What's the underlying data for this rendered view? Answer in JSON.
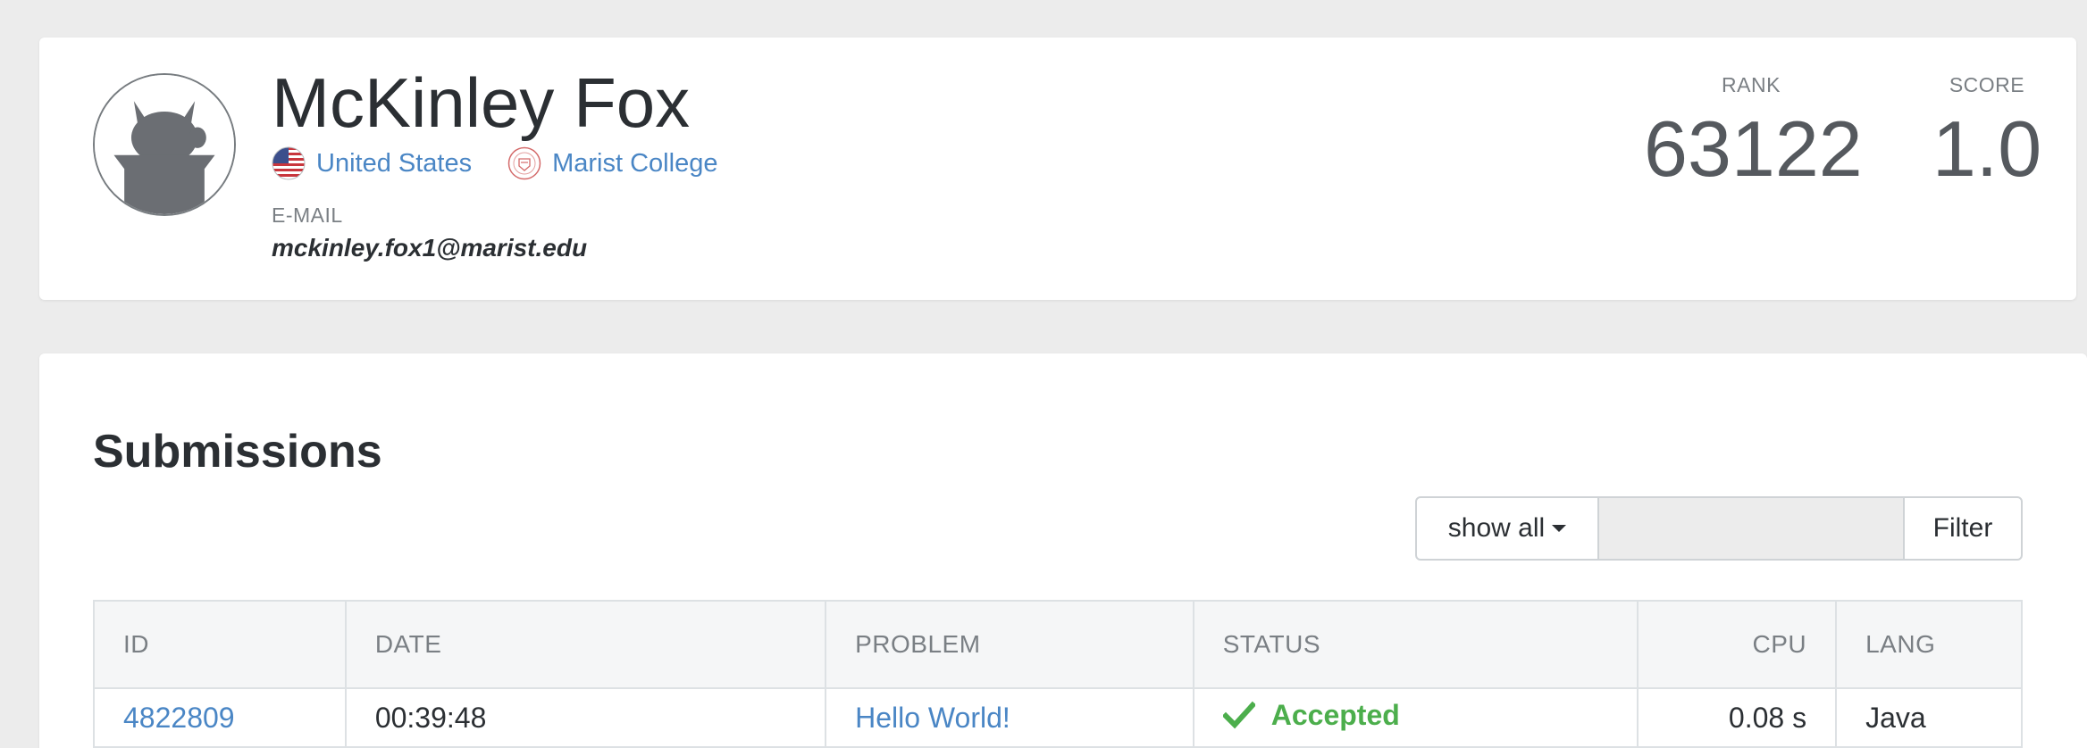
{
  "profile": {
    "name": "McKinley Fox",
    "country": "United States",
    "university": "Marist College",
    "email_label": "E-MAIL",
    "email": "mckinley.fox1@marist.edu",
    "rank_label": "RANK",
    "rank": "63122",
    "score_label": "SCORE",
    "score": "1.0"
  },
  "submissions": {
    "title": "Submissions",
    "filter": {
      "dropdown_value": "show all",
      "input_value": "",
      "button_label": "Filter"
    },
    "columns": {
      "id": "ID",
      "date": "DATE",
      "problem": "PROBLEM",
      "status": "STATUS",
      "cpu": "CPU",
      "lang": "LANG"
    },
    "rows": [
      {
        "id": "4822809",
        "date": "00:39:48",
        "problem": "Hello World!",
        "status": "Accepted",
        "cpu": "0.08 s",
        "lang": "Java"
      }
    ]
  },
  "colors": {
    "link": "#4a86c5",
    "accepted": "#4cae4c",
    "background": "#ececec",
    "card": "#ffffff"
  },
  "icons": {
    "avatar": "default-avatar-icon",
    "country": "us-flag-icon",
    "university": "university-seal-icon",
    "status": "checkmark-icon",
    "dropdown": "caret-down-icon"
  }
}
